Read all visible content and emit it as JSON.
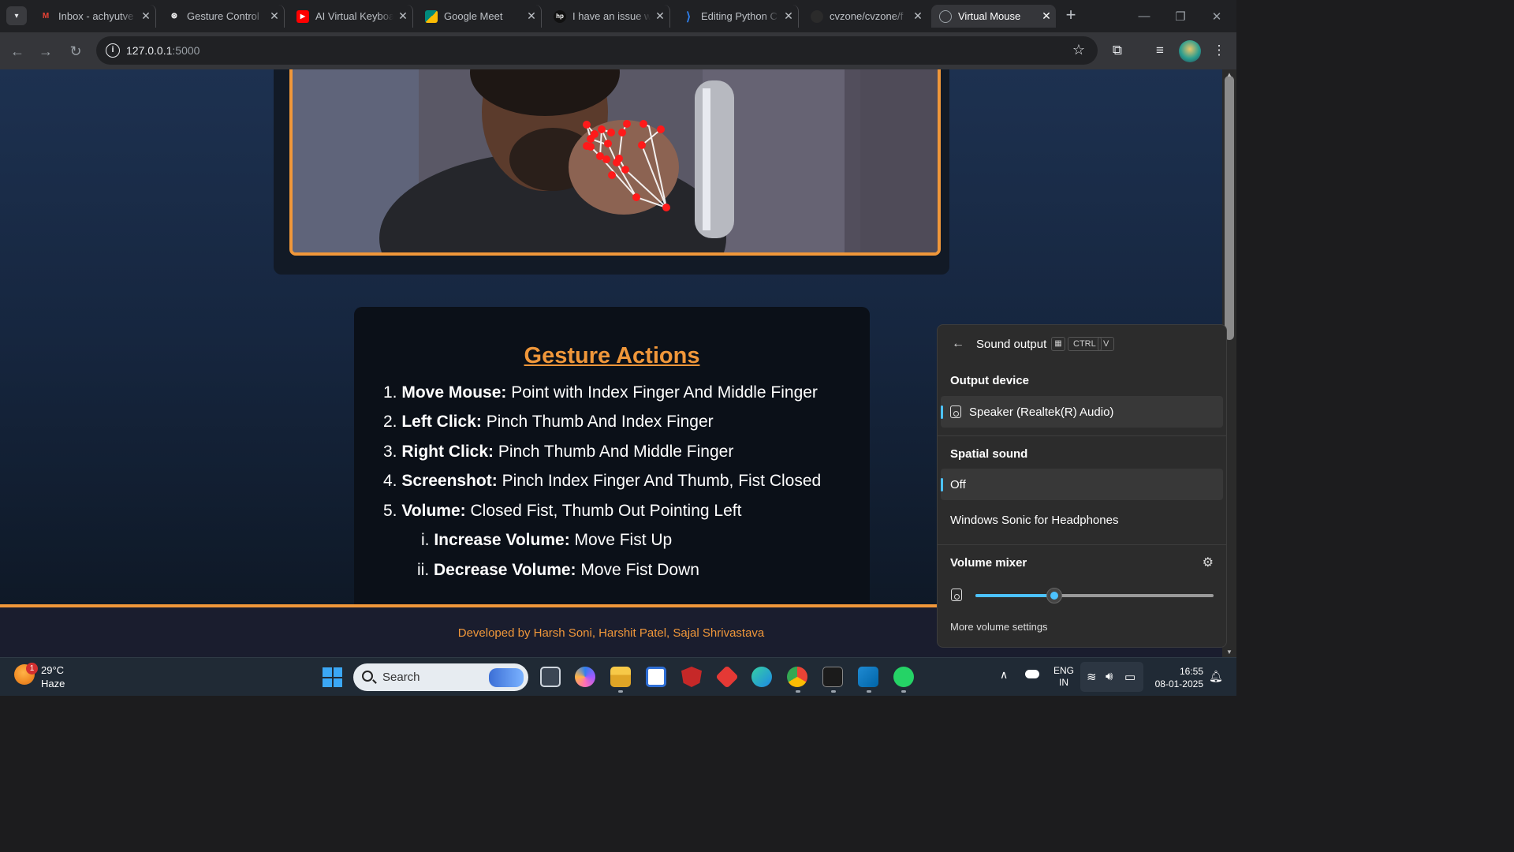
{
  "browser": {
    "tabs": [
      {
        "title": "Inbox - achyutve",
        "icon": "gmail-icon",
        "color": "#ea4335",
        "glyph": "M"
      },
      {
        "title": "Gesture Control",
        "icon": "chatgpt-icon",
        "color": "#ffffff",
        "glyph": "⊛"
      },
      {
        "title": "AI Virtual Keyboa",
        "icon": "youtube-icon",
        "color": "#ff0000",
        "glyph": "▶"
      },
      {
        "title": "Google Meet",
        "icon": "google-meet-icon",
        "color": "#00897b",
        "glyph": "■"
      },
      {
        "title": "I have an issue w",
        "icon": "hp-icon",
        "color": "#111111",
        "glyph": "hp"
      },
      {
        "title": "Editing Python C",
        "icon": "vscode-icon",
        "color": "#2f80ed",
        "glyph": "⟩"
      },
      {
        "title": "cvzone/cvzone/f",
        "icon": "github-icon",
        "color": "#2b2b2b",
        "glyph": "●"
      },
      {
        "title": "Virtual Mouse",
        "icon": "globe-icon",
        "color": "#6b6f75",
        "glyph": "◎"
      }
    ],
    "url_host": "127.0.0.1",
    "url_port": ":5000"
  },
  "page": {
    "gesture_title": "Gesture Actions",
    "items": [
      {
        "num": "1.",
        "bold": "Move Mouse:",
        "text": " Point with Index Finger And Middle Finger"
      },
      {
        "num": "2.",
        "bold": "Left Click:",
        "text": " Pinch Thumb And Index Finger"
      },
      {
        "num": "3.",
        "bold": "Right Click:",
        "text": " Pinch Thumb And Middle Finger"
      },
      {
        "num": "4.",
        "bold": "Screenshot:",
        "text": " Pinch Index Finger And Thumb, Fist Closed"
      },
      {
        "num": "5.",
        "bold": "Volume:",
        "text": " Closed Fist, Thumb Out Pointing Left"
      }
    ],
    "subitems": [
      {
        "num": "i.",
        "bold": "Increase Volume:",
        "text": " Move Fist Up"
      },
      {
        "num": "ii.",
        "bold": "Decrease Volume:",
        "text": " Move Fist Down"
      }
    ],
    "footer": "Developed by Harsh Soni, Harshit Patel, Sajal Shrivastava"
  },
  "flyout": {
    "title": "Sound output",
    "key1": "CTRL",
    "key2": "V",
    "output_device_label": "Output device",
    "output_device": "Speaker (Realtek(R) Audio)",
    "spatial_label": "Spatial sound",
    "spatial_off": "Off",
    "spatial_windows_sonic": "Windows Sonic for Headphones",
    "mixer_label": "Volume mixer",
    "volume_fraction": 0.33,
    "more": "More volume settings"
  },
  "taskbar": {
    "weather_badge": "1",
    "temp": "29°C",
    "condition": "Haze",
    "search": "Search",
    "lang1": "ENG",
    "lang2": "IN",
    "time": "16:55",
    "date": "08-01-2025"
  },
  "colors": {
    "accent": "#f0973a",
    "windows_accent": "#4cc2ff"
  }
}
